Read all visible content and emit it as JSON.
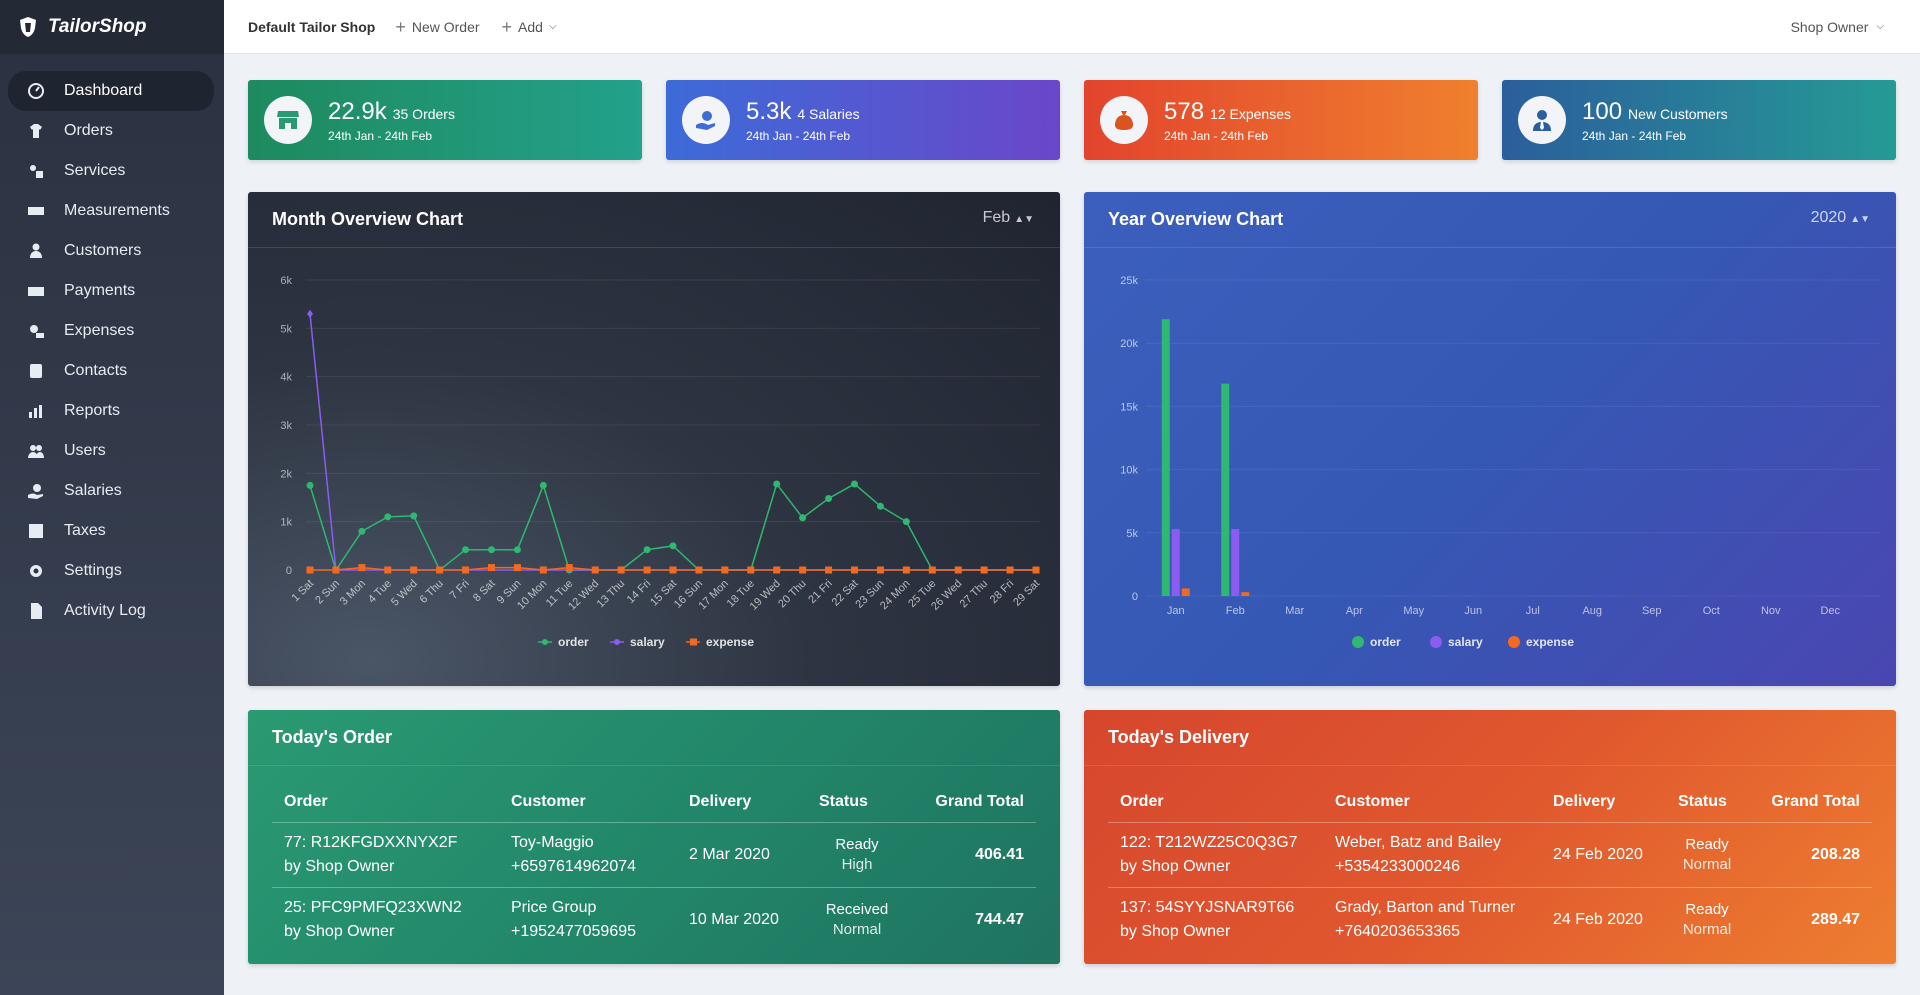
{
  "brand": {
    "name": "TailorShop"
  },
  "sidebar": {
    "items": [
      {
        "label": "Dashboard",
        "icon": "gauge-icon",
        "active": true
      },
      {
        "label": "Orders",
        "icon": "tshirt-icon"
      },
      {
        "label": "Services",
        "icon": "services-icon"
      },
      {
        "label": "Measurements",
        "icon": "ruler-icon"
      },
      {
        "label": "Customers",
        "icon": "customer-icon"
      },
      {
        "label": "Payments",
        "icon": "money-icon"
      },
      {
        "label": "Expenses",
        "icon": "expense-icon"
      },
      {
        "label": "Contacts",
        "icon": "contacts-icon"
      },
      {
        "label": "Reports",
        "icon": "chart-icon"
      },
      {
        "label": "Users",
        "icon": "users-icon"
      },
      {
        "label": "Salaries",
        "icon": "salary-icon"
      },
      {
        "label": "Taxes",
        "icon": "tax-icon"
      },
      {
        "label": "Settings",
        "icon": "gear-icon"
      },
      {
        "label": "Activity Log",
        "icon": "log-icon"
      }
    ]
  },
  "topbar": {
    "shop_name": "Default Tailor Shop",
    "new_order": "New Order",
    "add": "Add",
    "user": "Shop Owner"
  },
  "stats": [
    {
      "value": "22.9k",
      "label": "35 Orders",
      "range": "24th Jan - 24th Feb",
      "icon": "store-icon"
    },
    {
      "value": "5.3k",
      "label": "4 Salaries",
      "range": "24th Jan - 24th Feb",
      "icon": "salary-hand-icon"
    },
    {
      "value": "578",
      "label": "12 Expenses",
      "range": "24th Jan - 24th Feb",
      "icon": "money-bag-icon"
    },
    {
      "value": "100",
      "label": "New Customers",
      "range": "24th Jan - 24th Feb",
      "icon": "user-tie-icon"
    }
  ],
  "colors": {
    "order": "#2eb872",
    "salary": "#8a5cf0",
    "expense": "#f26a21"
  },
  "month_chart": {
    "title": "Month Overview Chart",
    "select": "Feb"
  },
  "year_chart": {
    "title": "Year Overview Chart",
    "select": "2020"
  },
  "chart_data": [
    {
      "type": "line",
      "title": "Month Overview Chart",
      "categories": [
        "1 Sat",
        "2 Sun",
        "3 Mon",
        "4 Tue",
        "5 Wed",
        "6 Thu",
        "7 Fri",
        "8 Sat",
        "9 Sun",
        "10 Mon",
        "11 Tue",
        "12 Wed",
        "13 Thu",
        "14 Fri",
        "15 Sat",
        "16 Sun",
        "17 Mon",
        "18 Tue",
        "19 Wed",
        "20 Thu",
        "21 Fri",
        "22 Sat",
        "23 Sun",
        "24 Mon",
        "25 Tue",
        "26 Wed",
        "27 Thu",
        "28 Fri",
        "29 Sat"
      ],
      "yticks": [
        "0",
        "1k",
        "2k",
        "3k",
        "4k",
        "5k",
        "6k"
      ],
      "ylim": [
        0,
        6000
      ],
      "grid": true,
      "legend": "bottom",
      "series": [
        {
          "name": "order",
          "values": [
            1750,
            0,
            800,
            1100,
            1120,
            0,
            420,
            420,
            420,
            1750,
            0,
            0,
            0,
            420,
            500,
            0,
            0,
            0,
            1780,
            1080,
            1480,
            1780,
            1320,
            1000,
            0,
            0,
            0,
            0,
            0
          ]
        },
        {
          "name": "salary",
          "values": [
            5300,
            0,
            0,
            0,
            0,
            0,
            0,
            0,
            0,
            0,
            0,
            0,
            0,
            0,
            0,
            0,
            0,
            0,
            0,
            0,
            0,
            0,
            0,
            0,
            0,
            0,
            0,
            0,
            0
          ]
        },
        {
          "name": "expense",
          "values": [
            0,
            0,
            50,
            0,
            0,
            0,
            0,
            50,
            50,
            0,
            50,
            0,
            0,
            0,
            0,
            0,
            0,
            0,
            0,
            0,
            0,
            0,
            0,
            0,
            0,
            0,
            0,
            0,
            0
          ]
        }
      ]
    },
    {
      "type": "bar",
      "title": "Year Overview Chart",
      "categories": [
        "Jan",
        "Feb",
        "Mar",
        "Apr",
        "May",
        "Jun",
        "Jul",
        "Aug",
        "Sep",
        "Oct",
        "Nov",
        "Dec"
      ],
      "yticks": [
        "0",
        "5k",
        "10k",
        "15k",
        "20k",
        "25k"
      ],
      "ylim": [
        0,
        25000
      ],
      "grid": true,
      "legend": "bottom",
      "series": [
        {
          "name": "order",
          "values": [
            21900,
            16800,
            0,
            0,
            0,
            0,
            0,
            0,
            0,
            0,
            0,
            0
          ]
        },
        {
          "name": "salary",
          "values": [
            5300,
            5300,
            0,
            0,
            0,
            0,
            0,
            0,
            0,
            0,
            0,
            0
          ]
        },
        {
          "name": "expense",
          "values": [
            600,
            300,
            0,
            0,
            0,
            0,
            0,
            0,
            0,
            0,
            0,
            0
          ]
        }
      ]
    }
  ],
  "today_order": {
    "title": "Today's Order",
    "headers": [
      "Order",
      "Customer",
      "Delivery",
      "Status",
      "Grand Total"
    ],
    "rows": [
      {
        "order": "77: R12KFGDXXNYX2F",
        "by": "by Shop Owner",
        "customer": "Toy-Maggio",
        "phone": "+6597614962074",
        "delivery": "2 Mar 2020",
        "status": "Ready",
        "priority": "High",
        "total": "406.41"
      },
      {
        "order": "25: PFC9PMFQ23XWN2",
        "by": "by Shop Owner",
        "customer": "Price Group",
        "phone": "+1952477059695",
        "delivery": "10 Mar 2020",
        "status": "Received",
        "priority": "Normal",
        "total": "744.47"
      }
    ]
  },
  "today_delivery": {
    "title": "Today's Delivery",
    "headers": [
      "Order",
      "Customer",
      "Delivery",
      "Status",
      "Grand Total"
    ],
    "rows": [
      {
        "order": "122: T212WZ25C0Q3G7",
        "by": "by Shop Owner",
        "customer": "Weber, Batz and Bailey",
        "phone": "+5354233000246",
        "delivery": "24 Feb 2020",
        "status": "Ready",
        "priority": "Normal",
        "total": "208.28"
      },
      {
        "order": "137: 54SYYJSNAR9T66",
        "by": "by Shop Owner",
        "customer": "Grady, Barton and Turner",
        "phone": "+7640203653365",
        "delivery": "24 Feb 2020",
        "status": "Ready",
        "priority": "Normal",
        "total": "289.47"
      }
    ]
  }
}
